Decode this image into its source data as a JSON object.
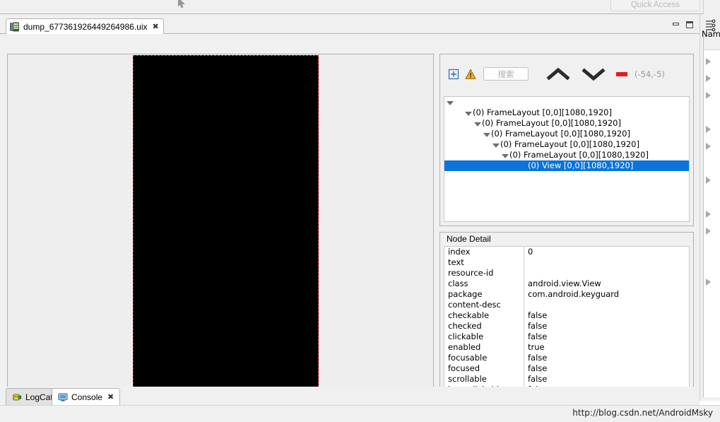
{
  "window": {
    "quick_access_label": "Quick Access",
    "minimize_label": "",
    "maximize_label": ""
  },
  "editor_tab": {
    "title": "dump_677361926449264986.uix",
    "close_glyph": "✖",
    "icon": "device-file-icon"
  },
  "screenshot_panel": {
    "name": "device-screenshot-preview",
    "selection_color": "#e8192c",
    "background_color": "#000000"
  },
  "tree_toolbar": {
    "expand_icon": "expand-all-icon",
    "warning_icon": "warning-triangle-icon",
    "search_placeholder": "搜索",
    "search_value": "",
    "prev_icon": "chevron-up-icon",
    "next_icon": "chevron-down-icon",
    "marker_color": "#e01b24",
    "coordinates": "(-54,-5)"
  },
  "tree": {
    "nodes": [
      {
        "indent": 0,
        "label": "",
        "twisty": "open",
        "selected": false
      },
      {
        "indent": 2,
        "label": "(0) FrameLayout [0,0][1080,1920]",
        "twisty": "open",
        "selected": false
      },
      {
        "indent": 3,
        "label": "(0) FrameLayout [0,0][1080,1920]",
        "twisty": "open",
        "selected": false
      },
      {
        "indent": 4,
        "label": "(0) FrameLayout [0,0][1080,1920]",
        "twisty": "open",
        "selected": false
      },
      {
        "indent": 5,
        "label": "(0) FrameLayout [0,0][1080,1920]",
        "twisty": "open",
        "selected": false
      },
      {
        "indent": 6,
        "label": "(0) FrameLayout [0,0][1080,1920]",
        "twisty": "open",
        "selected": false
      },
      {
        "indent": 8,
        "label": "(0) View [0,0][1080,1920]",
        "twisty": "blank",
        "selected": true
      }
    ],
    "selection_color": "#0a74dc"
  },
  "node_detail": {
    "title": "Node Detail",
    "rows": [
      {
        "key": "index",
        "value": "0"
      },
      {
        "key": "text",
        "value": ""
      },
      {
        "key": "resource-id",
        "value": ""
      },
      {
        "key": "class",
        "value": "android.view.View"
      },
      {
        "key": "package",
        "value": "com.android.keyguard"
      },
      {
        "key": "content-desc",
        "value": ""
      },
      {
        "key": "checkable",
        "value": "false"
      },
      {
        "key": "checked",
        "value": "false"
      },
      {
        "key": "clickable",
        "value": "false"
      },
      {
        "key": "enabled",
        "value": "true"
      },
      {
        "key": "focusable",
        "value": "false"
      },
      {
        "key": "focused",
        "value": "false"
      },
      {
        "key": "scrollable",
        "value": "false"
      },
      {
        "key": "long-clickable",
        "value": "false"
      }
    ]
  },
  "right_sidebar": {
    "view_icon": "outline-view-icon",
    "column_header": "Nam",
    "expand_arrows": [
      62,
      86,
      110,
      158,
      182,
      230,
      278,
      302,
      374
    ]
  },
  "bottom_tabs": {
    "items": [
      {
        "label": "LogCat",
        "icon": "logcat-icon",
        "active": false,
        "closable": false
      },
      {
        "label": "Console",
        "icon": "console-icon",
        "active": true,
        "closable": true
      }
    ],
    "close_glyph": "✖"
  },
  "status_bar": {
    "watermark": "http://blog.csdn.net/AndroidMsky"
  }
}
